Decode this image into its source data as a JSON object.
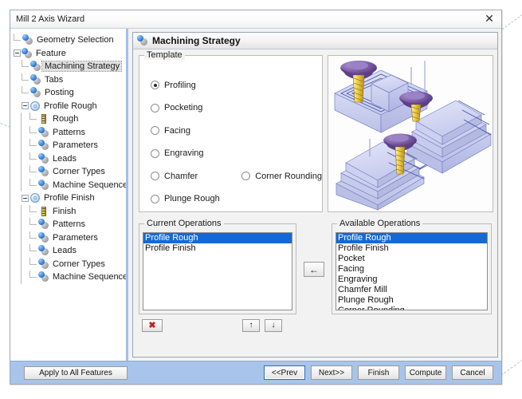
{
  "window": {
    "title": "Mill 2 Axis Wizard",
    "close_icon": "close-icon",
    "close_glyph": "✕"
  },
  "colors": {
    "accent_blue": "#1669d4",
    "footer_blue": "#a8c4ea",
    "sidebar_divider": "#a4bfe8",
    "delete_red": "#c21f24",
    "tool_yellow": "#e8c53a",
    "graphic_part": "#c3c8ec",
    "graphic_tool": "#6b4d8f"
  },
  "sidebar": {
    "items": [
      {
        "label": "Geometry Selection",
        "depth": 1,
        "icon": "sphere-node-icon",
        "expander": "none",
        "selected": false
      },
      {
        "label": "Feature",
        "depth": 1,
        "icon": "sphere-node-icon",
        "expander": "open",
        "selected": false
      },
      {
        "label": "Machining Strategy",
        "depth": 2,
        "icon": "sphere-node-icon",
        "expander": "none",
        "selected": true
      },
      {
        "label": "Tabs",
        "depth": 2,
        "icon": "sphere-node-icon",
        "expander": "none",
        "selected": false
      },
      {
        "label": "Posting",
        "depth": 2,
        "icon": "sphere-node-icon",
        "expander": "none",
        "selected": false
      },
      {
        "label": "Profile Rough",
        "depth": 2,
        "icon": "gear-node-icon",
        "expander": "open",
        "selected": false
      },
      {
        "label": "Rough",
        "depth": 3,
        "icon": "tool-node-icon",
        "expander": "none",
        "selected": false
      },
      {
        "label": "Patterns",
        "depth": 3,
        "icon": "sphere-node-icon",
        "expander": "none",
        "selected": false
      },
      {
        "label": "Parameters",
        "depth": 3,
        "icon": "sphere-node-icon",
        "expander": "none",
        "selected": false
      },
      {
        "label": "Leads",
        "depth": 3,
        "icon": "sphere-node-icon",
        "expander": "none",
        "selected": false
      },
      {
        "label": "Corner Types",
        "depth": 3,
        "icon": "sphere-node-icon",
        "expander": "none",
        "selected": false
      },
      {
        "label": "Machine Sequence",
        "depth": 3,
        "icon": "sphere-node-icon",
        "expander": "none",
        "selected": false
      },
      {
        "label": "Profile Finish",
        "depth": 2,
        "icon": "gear-node-icon",
        "expander": "open",
        "selected": false
      },
      {
        "label": "Finish",
        "depth": 3,
        "icon": "tool-node-icon",
        "expander": "none",
        "selected": false
      },
      {
        "label": "Patterns",
        "depth": 3,
        "icon": "sphere-node-icon",
        "expander": "none",
        "selected": false
      },
      {
        "label": "Parameters",
        "depth": 3,
        "icon": "sphere-node-icon",
        "expander": "none",
        "selected": false
      },
      {
        "label": "Leads",
        "depth": 3,
        "icon": "sphere-node-icon",
        "expander": "none",
        "selected": false
      },
      {
        "label": "Corner Types",
        "depth": 3,
        "icon": "sphere-node-icon",
        "expander": "none",
        "selected": false
      },
      {
        "label": "Machine Sequence",
        "depth": 3,
        "icon": "sphere-node-icon",
        "expander": "none",
        "selected": false
      }
    ]
  },
  "pane": {
    "header_title": "Machining Strategy",
    "header_icon": "sphere-node-icon"
  },
  "template": {
    "legend": "Template",
    "selected": "Profiling",
    "options": [
      {
        "label": "Profiling",
        "selected": true,
        "column": 1
      },
      {
        "label": "Pocketing",
        "selected": false,
        "column": 1
      },
      {
        "label": "Facing",
        "selected": false,
        "column": 1
      },
      {
        "label": "Engraving",
        "selected": false,
        "column": 1
      },
      {
        "label": "Chamfer",
        "selected": false,
        "column": 1
      },
      {
        "label": "Corner Rounding",
        "selected": false,
        "column": 2
      },
      {
        "label": "Plunge Rough",
        "selected": false,
        "column": 1
      }
    ]
  },
  "graphic": {
    "name": "milling-preview-illustration",
    "description": "3D illustration of three milling operations with rotary tools over stepped block workpieces"
  },
  "current_operations": {
    "legend": "Current Operations",
    "items": [
      {
        "label": "Profile Rough",
        "selected": true
      },
      {
        "label": "Profile Finish",
        "selected": false
      }
    ]
  },
  "available_operations": {
    "legend": "Available Operations",
    "items": [
      {
        "label": "Profile Rough",
        "selected": true
      },
      {
        "label": "Profile Finish",
        "selected": false
      },
      {
        "label": "Pocket",
        "selected": false
      },
      {
        "label": "Facing",
        "selected": false
      },
      {
        "label": "Engraving",
        "selected": false
      },
      {
        "label": "Chamfer Mill",
        "selected": false
      },
      {
        "label": "Plunge Rough",
        "selected": false
      },
      {
        "label": "Corner Rounding",
        "selected": false
      }
    ]
  },
  "transfer": {
    "add_icon": "arrow-left-icon",
    "add_glyph": "←"
  },
  "ops_toolbar": {
    "delete_icon": "delete-x-icon",
    "delete_glyph": "✖",
    "move_up_icon": "arrow-up-icon",
    "move_up_glyph": "↑",
    "move_down_icon": "arrow-down-icon",
    "move_down_glyph": "↓"
  },
  "footer": {
    "apply_label": "Apply to All Features",
    "buttons": [
      {
        "label": "<<Prev",
        "focused": true
      },
      {
        "label": "Next>>",
        "focused": false
      },
      {
        "label": "Finish",
        "focused": false
      },
      {
        "label": "Compute",
        "focused": false
      },
      {
        "label": "Cancel",
        "focused": false
      }
    ]
  }
}
